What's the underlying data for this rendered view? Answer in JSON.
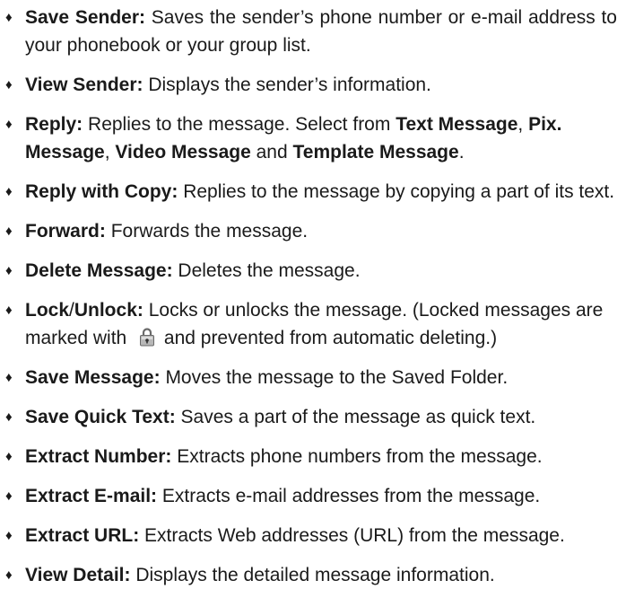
{
  "bullet_glyph": "♦",
  "items": [
    {
      "term": "Save Sender:",
      "desc": "Saves the sender’s phone number or e-mail address to your phonebook or your group list."
    },
    {
      "term": "View Sender:",
      "desc": "Displays the sender’s information."
    },
    {
      "term": "Reply:",
      "desc_start": "Replies to the message. Select from",
      "options": [
        "Text Message",
        "Pix. Message",
        "Video Message",
        "Template Message"
      ],
      "sep_comma": ",",
      "sep_and": "and",
      "end": "."
    },
    {
      "term": "Reply with Copy:",
      "desc": "Replies to the message by copying a part of its text."
    },
    {
      "term": "Forward:",
      "desc": "Forwards the message."
    },
    {
      "term": "Delete Message:",
      "desc": "Deletes the message."
    },
    {
      "term_a": "Lock",
      "term_slash": "/",
      "term_b": "Unlock:",
      "desc_a": "Locks or unlocks the message. (Locked messages are marked with",
      "icon": "lock-icon",
      "desc_b": "and prevented from automatic deleting.)"
    },
    {
      "term": "Save Message:",
      "desc": "Moves the message to the Saved Folder."
    },
    {
      "term": "Save Quick Text:",
      "desc": "Saves a part of the message as quick text."
    },
    {
      "term": "Extract Number:",
      "desc": "Extracts phone numbers from the message."
    },
    {
      "term": "Extract E-mail:",
      "desc": "Extracts e-mail addresses from the message."
    },
    {
      "term": "Extract URL:",
      "desc": "Extracts Web addresses (URL) from the message."
    },
    {
      "term": "View Detail:",
      "desc": "Displays the detailed message information."
    }
  ]
}
